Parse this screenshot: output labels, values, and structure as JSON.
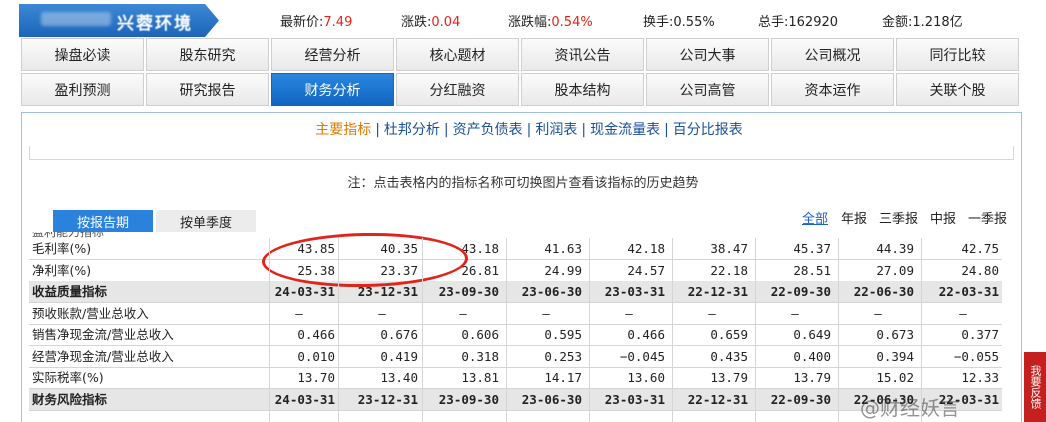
{
  "header": {
    "stock_code": "000000",
    "stock_name": "兴蓉环境"
  },
  "quote": {
    "price_label": "最新价:",
    "price_value": "7.49",
    "change_label": "涨跌:",
    "change_value": "0.04",
    "change_pct_label": "涨跌幅:",
    "change_pct_value": "0.54%",
    "turnover_label": "换手:",
    "turnover_value": "0.55%",
    "volume_label": "总手:",
    "volume_value": "162920",
    "amount_label": "金额:",
    "amount_value": "1.218亿"
  },
  "nav": {
    "row1": [
      "操盘必读",
      "股东研究",
      "经营分析",
      "核心题材",
      "资讯公告",
      "公司大事",
      "公司概况",
      "同行比较"
    ],
    "row2": [
      "盈利预测",
      "研究报告",
      "财务分析",
      "分红融资",
      "股本结构",
      "公司高管",
      "资本运作",
      "关联个股"
    ],
    "active": "财务分析"
  },
  "subnav": {
    "items": [
      "主要指标",
      "杜邦分析",
      "资产负债表",
      "利润表",
      "现金流量表",
      "百分比报表"
    ],
    "separator": "|"
  },
  "note": "注：点击表格内的指标名称可切换图片查看该指标的历史趋势",
  "period_tabs": [
    "按报告期",
    "按单季度"
  ],
  "period_filters": [
    "全部",
    "年报",
    "三季报",
    "中报",
    "一季报"
  ],
  "table": {
    "rows": [
      {
        "name": "毛利率(%)",
        "section": false,
        "values": [
          "43.85",
          "40.35",
          "43.18",
          "41.63",
          "42.18",
          "38.47",
          "45.37",
          "44.39",
          "42.75"
        ]
      },
      {
        "name": "净利率(%)",
        "section": false,
        "values": [
          "25.38",
          "23.37",
          "26.81",
          "24.99",
          "24.57",
          "22.18",
          "28.51",
          "27.09",
          "24.80"
        ]
      },
      {
        "name": "收益质量指标",
        "section": true,
        "values": [
          "24-03-31",
          "23-12-31",
          "23-09-30",
          "23-06-30",
          "23-03-31",
          "22-12-31",
          "22-09-30",
          "22-06-30",
          "22-03-31"
        ]
      },
      {
        "name": "预收账款/营业总收入",
        "section": false,
        "values": [
          "—",
          "—",
          "—",
          "—",
          "—",
          "—",
          "—",
          "—",
          "—"
        ]
      },
      {
        "name": "销售净现金流/营业总收入",
        "section": false,
        "values": [
          "0.466",
          "0.676",
          "0.606",
          "0.595",
          "0.466",
          "0.659",
          "0.649",
          "0.673",
          "0.377"
        ]
      },
      {
        "name": "经营净现金流/营业总收入",
        "section": false,
        "values": [
          "0.010",
          "0.419",
          "0.318",
          "0.253",
          "−0.045",
          "0.435",
          "0.400",
          "0.394",
          "−0.055"
        ]
      },
      {
        "name": "实际税率(%)",
        "section": false,
        "values": [
          "13.70",
          "13.40",
          "13.81",
          "14.17",
          "13.60",
          "13.79",
          "13.79",
          "15.02",
          "12.33"
        ]
      },
      {
        "name": "财务风险指标",
        "section": true,
        "values": [
          "24-03-31",
          "23-12-31",
          "23-09-30",
          "23-06-30",
          "23-03-31",
          "22-12-31",
          "22-09-30",
          "22-06-30",
          "22-03-31"
        ]
      }
    ]
  },
  "feedback_label": "我要反馈",
  "watermark": "@财经妖言",
  "colors": {
    "accent_blue": "#1166c2",
    "up_red": "#e2231a",
    "highlight_red": "#e0241b"
  }
}
